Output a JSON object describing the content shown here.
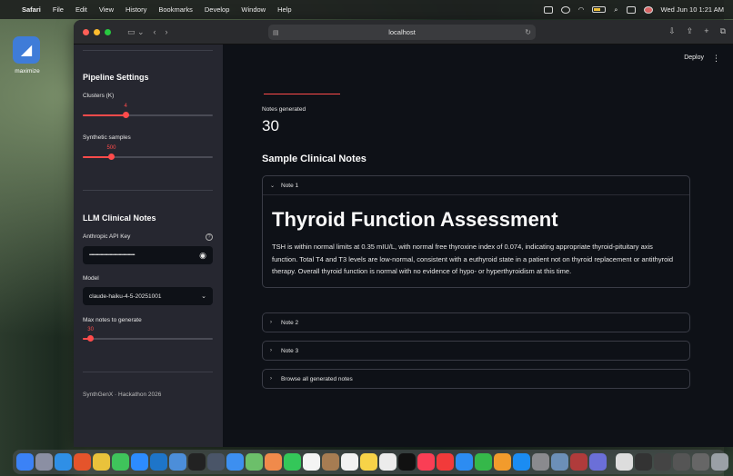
{
  "menubar": {
    "app": "Safari",
    "items": [
      "File",
      "Edit",
      "View",
      "History",
      "Bookmarks",
      "Develop",
      "Window",
      "Help"
    ],
    "clock": "Wed Jun 10  1:21 AM"
  },
  "desktop": {
    "icon_label": "maximize"
  },
  "browser": {
    "url": "localhost"
  },
  "sidebar": {
    "pipeline_title": "Pipeline Settings",
    "clusters": {
      "label": "Clusters (K)",
      "value": "4",
      "fraction": 0.33
    },
    "samples": {
      "label": "Synthetic samples",
      "value": "500",
      "fraction": 0.22
    },
    "llm_title": "LLM Clinical Notes",
    "api_key": {
      "label": "Anthropic API Key",
      "masked": "••••••••••••••••••••••••••••••••••••••••"
    },
    "model": {
      "label": "Model",
      "value": "claude-haiku-4-5-20251001"
    },
    "max_notes": {
      "label": "Max notes to generate",
      "value": "30",
      "fraction": 0.06
    },
    "footer": "SynthGenX · Hackathon 2026"
  },
  "main": {
    "deploy": "Deploy",
    "metric_label": "Notes generated",
    "metric_value": "30",
    "section_title": "Sample Clinical Notes",
    "note1": {
      "label": "Note 1",
      "title": "Thyroid Function Assessment",
      "body": "TSH is within normal limits at 0.35 mIU/L, with normal free thyroxine index of 0.074, indicating appropriate thyroid-pituitary axis function. Total T4 and T3 levels are low-normal, consistent with a euthyroid state in a patient not on thyroid replacement or antithyroid therapy. Overall thyroid function is normal with no evidence of hypo- or hyperthyroidism at this time."
    },
    "note2": "Note 2",
    "note3": "Note 3",
    "browse": "Browse all generated notes"
  },
  "colors": {
    "accent": "#ff4b4b",
    "sidebar_bg": "#262730",
    "main_bg": "#0e1117"
  }
}
